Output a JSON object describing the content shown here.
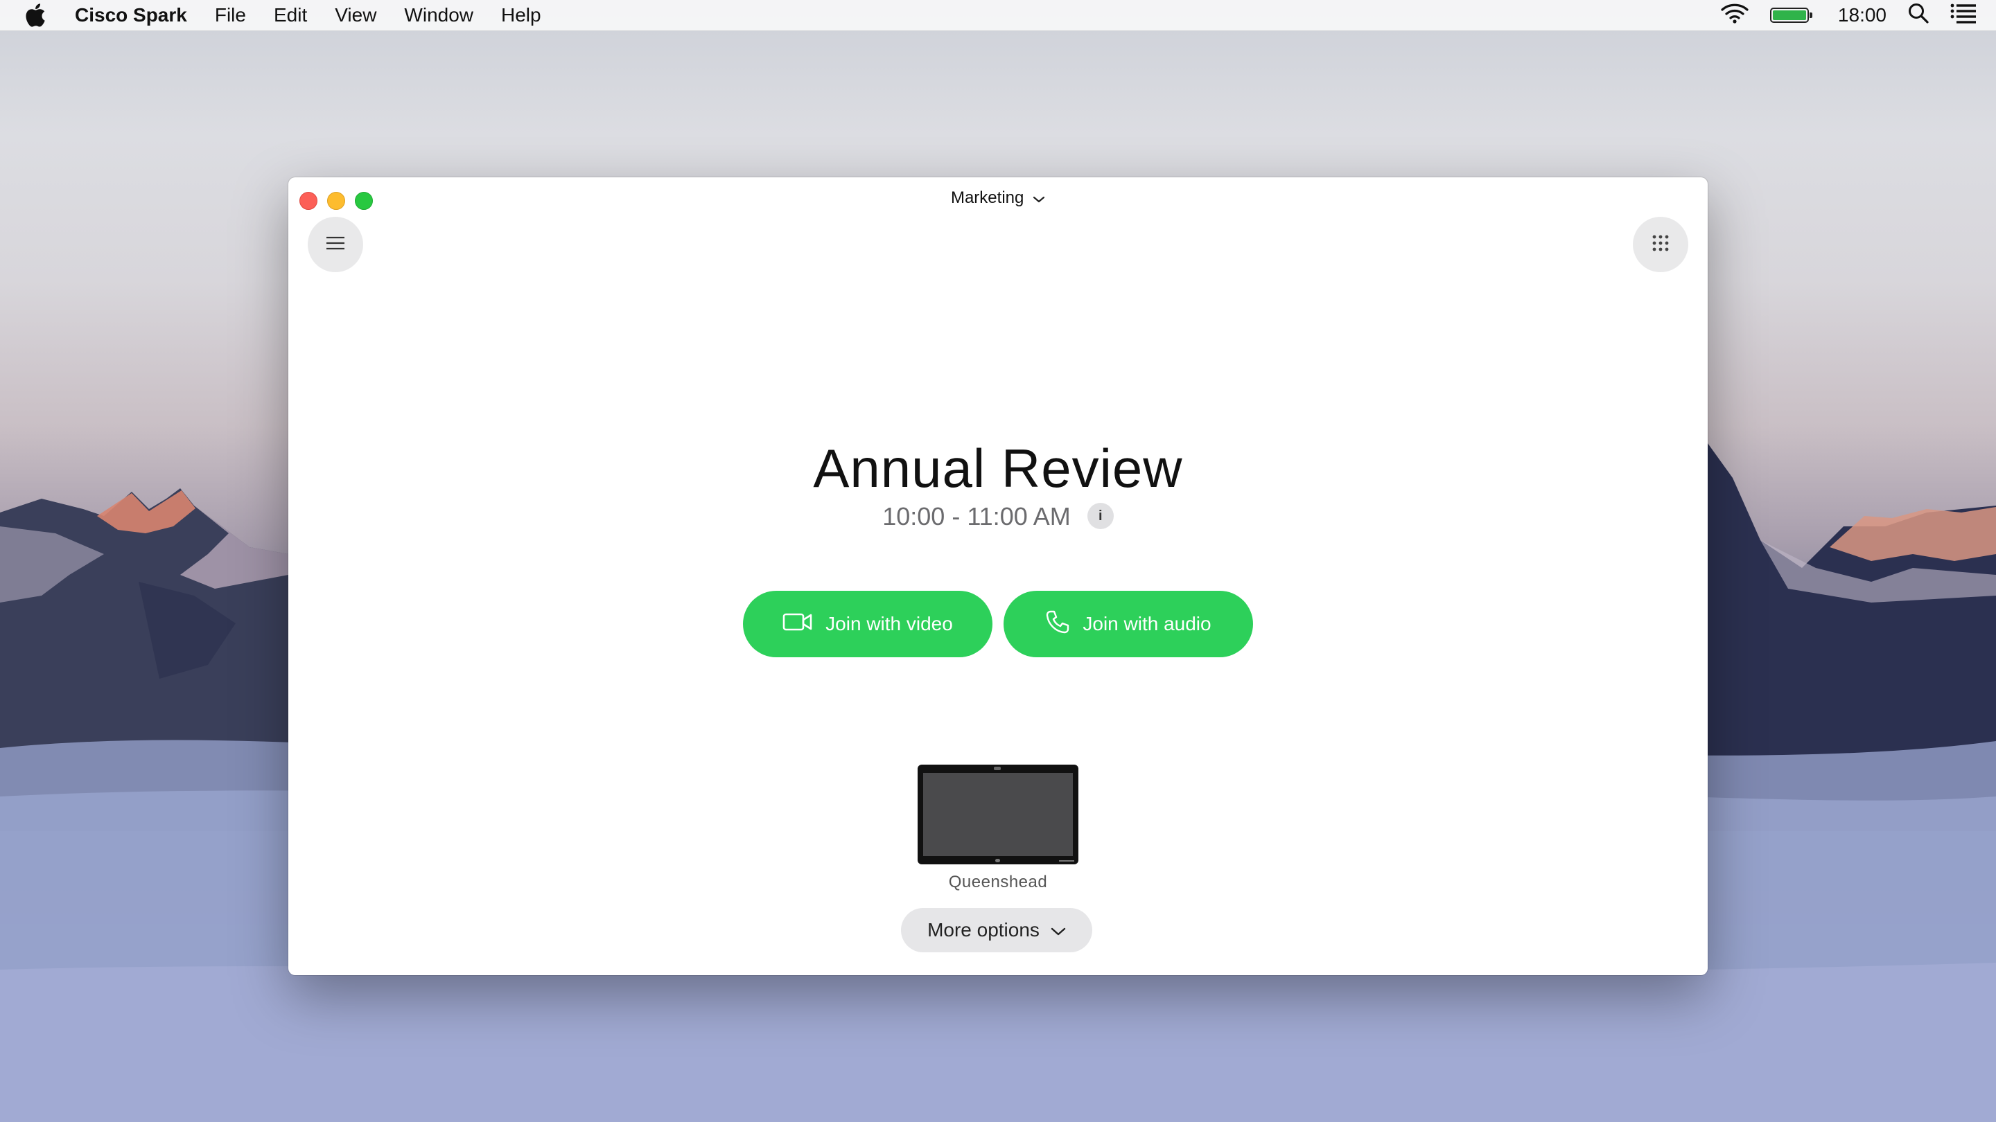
{
  "menubar": {
    "app_name": "Cisco Spark",
    "menus": [
      "File",
      "Edit",
      "View",
      "Window",
      "Help"
    ],
    "clock": "18:00",
    "status_icons": [
      "wifi-icon",
      "battery-icon",
      "spotlight-search-icon",
      "notification-center-icon"
    ],
    "battery_level": 1.0
  },
  "window": {
    "space_name": "Marketing",
    "menu_button_icon": "hamburger-icon",
    "apps_button_icon": "grid-dots-icon"
  },
  "meeting": {
    "title": "Annual Review",
    "time": "10:00 - 11:00 AM",
    "info_label": "i"
  },
  "actions": {
    "join_video_label": "Join with video",
    "join_audio_label": "Join with audio",
    "more_options_label": "More options"
  },
  "device": {
    "name": "Queenshead"
  },
  "colors": {
    "join_green": "#2dd05a",
    "close": "#fc5f57",
    "minimize": "#fdbc2e",
    "maximize": "#28c840"
  }
}
